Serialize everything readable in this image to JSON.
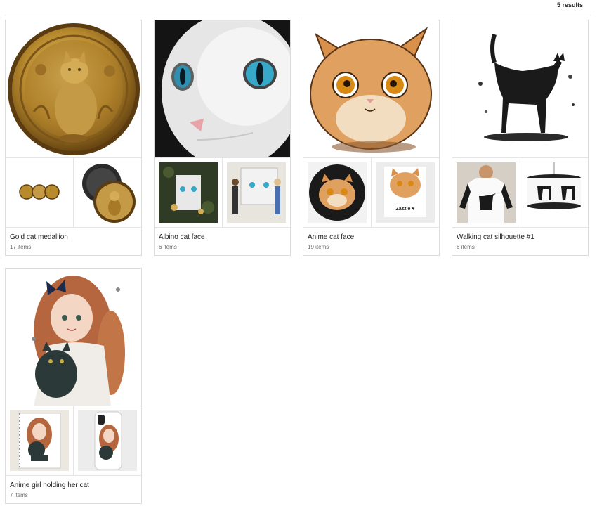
{
  "header": {
    "results_label": "5 results"
  },
  "collections": [
    {
      "title": "Gold cat medallion",
      "count": "17 items",
      "hero_icon": "gold-cat-medallion-image",
      "thumbs": [
        "medallion-set-image",
        "medallion-magnet-image"
      ]
    },
    {
      "title": "Albino cat face",
      "count": "6 items",
      "hero_icon": "albino-cat-face-image",
      "thumbs": [
        "cat-ornament-image",
        "cat-wall-tapestry-image"
      ]
    },
    {
      "title": "Anime cat face",
      "count": "19 items",
      "hero_icon": "anime-cat-face-image",
      "thumbs": [
        "cat-button-image",
        "cat-sticker-image"
      ],
      "sticker_text": "Zazzle ♥"
    },
    {
      "title": "Walking cat silhouette #1",
      "count": "6 items",
      "hero_icon": "walking-cat-silhouette-image",
      "thumbs": [
        "cat-raglan-shirt-image",
        "cat-lamp-shade-image"
      ]
    },
    {
      "title": "Anime girl holding her cat",
      "count": "7 items",
      "hero_icon": "anime-girl-with-cat-image",
      "thumbs": [
        "girl-notebook-image",
        "girl-phone-case-image"
      ]
    }
  ]
}
